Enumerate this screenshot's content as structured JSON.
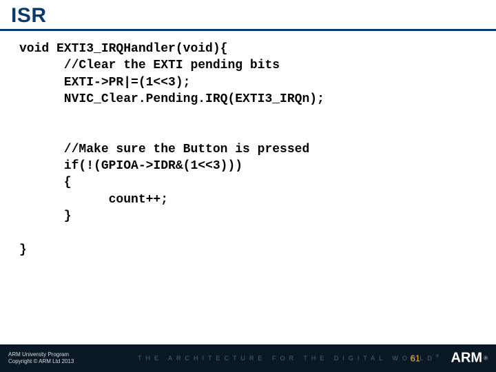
{
  "slide": {
    "title": "ISR",
    "code": {
      "line1": "void EXTI3_IRQHandler(void){",
      "line2": "      //Clear the EXTI pending bits",
      "line3": "      EXTI->PR|=(1<<3);",
      "line4": "      NVIC_Clear.Pending.IRQ(EXTI3_IRQn);",
      "line5": "",
      "line6": "",
      "line7": "      //Make sure the Button is pressed",
      "line8": "      if(!(GPIOA->IDR&(1<<3)))",
      "line9": "      {",
      "line10": "            count++;",
      "line11": "      }",
      "line12": "",
      "line13": "}"
    }
  },
  "footer": {
    "program": "ARM University Program",
    "copyright": "Copyright © ARM Ltd 2013",
    "tagline": "THE ARCHITECTURE FOR THE DIGITAL WORLD",
    "tagline_mark": "®",
    "page": "61",
    "logo": "ARM",
    "logo_mark": "®"
  }
}
